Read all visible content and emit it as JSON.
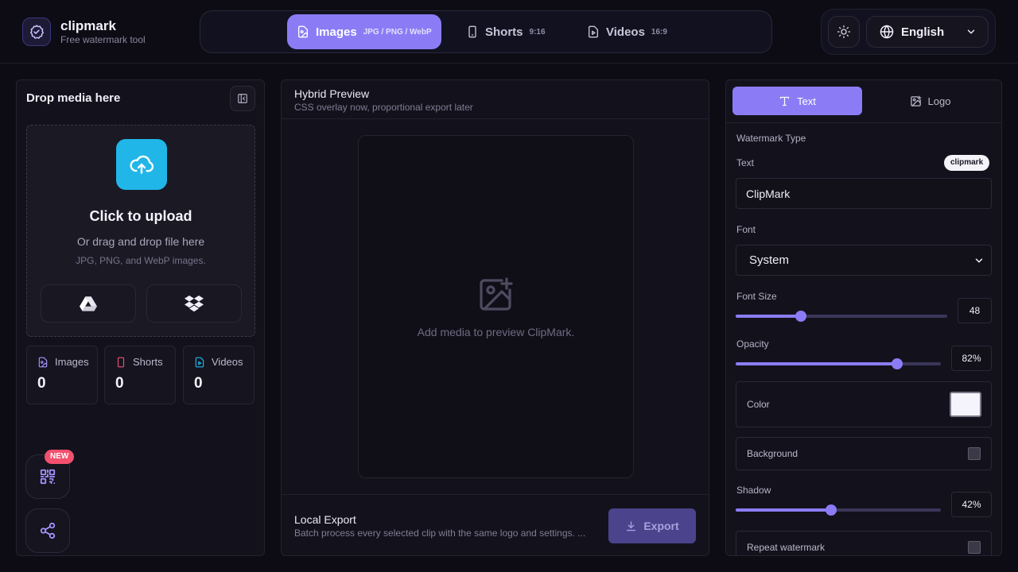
{
  "header": {
    "brand_name": "clipmark",
    "brand_tagline": "Free watermark tool",
    "tabs": [
      {
        "label": "Images",
        "sub": "JPG / PNG / WebP"
      },
      {
        "label": "Shorts",
        "sub": "9:16"
      },
      {
        "label": "Videos",
        "sub": "16:9"
      }
    ],
    "active_tab": "Images",
    "language": "English"
  },
  "left": {
    "title": "Drop media here",
    "upload_title": "Click to upload",
    "upload_sub": "Or drag and drop file here",
    "upload_note": "JPG, PNG, and WebP images.",
    "stats": [
      {
        "label": "Images",
        "value": "0"
      },
      {
        "label": "Shorts",
        "value": "0"
      },
      {
        "label": "Videos",
        "value": "0"
      }
    ],
    "new_badge": "NEW"
  },
  "center": {
    "title": "Hybrid Preview",
    "subtitle": "CSS overlay now, proportional export later",
    "empty_message": "Add media to preview ClipMark.",
    "export_title": "Local Export",
    "export_sub": "Batch process every selected clip with the same logo and settings. ...",
    "export_button": "Export"
  },
  "right": {
    "tabs": [
      {
        "label": "Text"
      },
      {
        "label": "Logo"
      }
    ],
    "watermark_type_label": "Watermark Type",
    "text_label": "Text",
    "text_chip": "clipmark",
    "text_value": "ClipMark",
    "font_label": "Font",
    "font_value": "System",
    "font_size_label": "Font Size",
    "font_size_value": "48",
    "font_size_fraction": 0.31,
    "opacity_label": "Opacity",
    "opacity_value": "82%",
    "opacity_fraction": 0.785,
    "color_label": "Color",
    "color_value": "#f5f3fb",
    "background_label": "Background",
    "shadow_label": "Shadow",
    "shadow_value": "42%",
    "shadow_fraction": 0.465,
    "repeat_label": "Repeat watermark"
  },
  "colors": {
    "accent": "#8b7cf6",
    "upload_icon_bg": "#21b6e8",
    "new_badge": "#f2506e"
  }
}
